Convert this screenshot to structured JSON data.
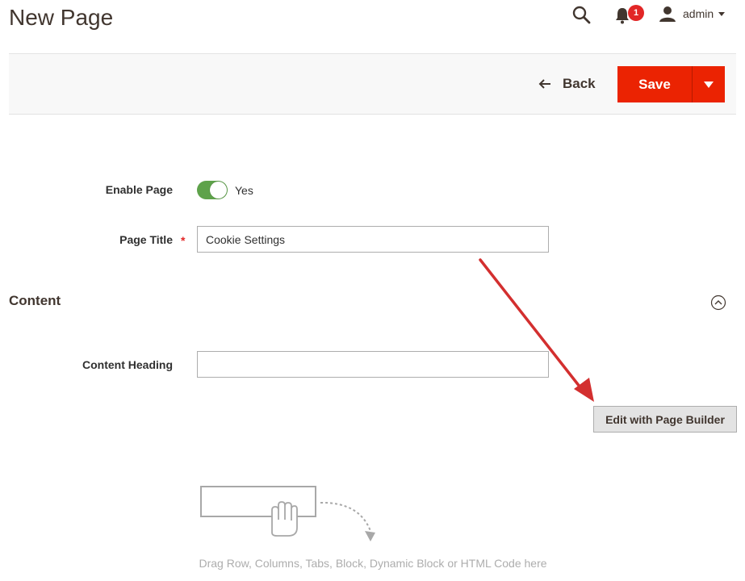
{
  "header": {
    "title": "New Page",
    "search_icon": "search-icon",
    "notifications": {
      "icon": "bell-icon",
      "count": "1"
    },
    "user": {
      "icon": "user-icon",
      "name": "admin"
    }
  },
  "actions": {
    "back_label": "Back",
    "save_label": "Save"
  },
  "form": {
    "enable_page": {
      "label": "Enable Page",
      "value": "Yes",
      "on": true
    },
    "page_title": {
      "label": "Page Title",
      "required_mark": "*",
      "value": "Cookie Settings"
    }
  },
  "content_section": {
    "title": "Content",
    "content_heading": {
      "label": "Content Heading",
      "value": ""
    },
    "page_builder_button": "Edit with Page Builder",
    "drop_hint": "Drag Row, Columns, Tabs, Block, Dynamic Block or HTML Code here"
  },
  "colors": {
    "primary": "#eb2302",
    "toggle_on": "#5ea24a",
    "badge": "#e22626",
    "annotation_arrow": "#d32f2f"
  }
}
